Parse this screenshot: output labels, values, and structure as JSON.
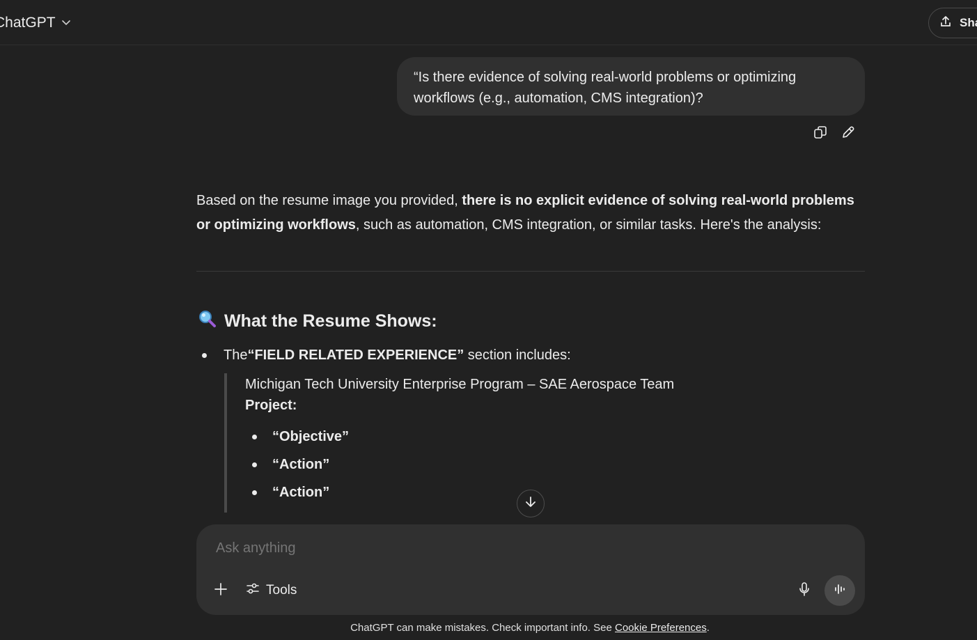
{
  "header": {
    "model_label": "ChatGPT",
    "share_label": "Share"
  },
  "conversation": {
    "user_message": "“Is there evidence of solving real-world problems or optimizing workflows (e.g., automation, CMS integration)?",
    "assistant": {
      "intro_prefix": "Based on the resume image you provided, ",
      "intro_bold": "there is no explicit evidence of solving real-world problems or optimizing workflows",
      "intro_suffix": ", such as automation, CMS integration, or similar tasks. Here's the analysis:",
      "section_title": "What the Resume Shows:",
      "bullet_prefix": "The ",
      "bullet_bold": "“FIELD RELATED EXPERIENCE”",
      "bullet_suffix": " section includes:",
      "quote_line1": "Michigan Tech University Enterprise Program – SAE Aerospace Team",
      "quote_line2": "Project:",
      "quote_items": [
        "“Objective”",
        "“Action”",
        "“Action”"
      ]
    }
  },
  "composer": {
    "placeholder": "Ask anything",
    "tools_label": "Tools"
  },
  "footer": {
    "text": "ChatGPT can make mistakes. Check important info. See ",
    "link": "Cookie Preferences",
    "end": "."
  },
  "icons": {
    "chevron": "chevron-down-icon",
    "share": "share-icon",
    "copy": "copy-icon",
    "edit": "edit-icon",
    "magnifier": "magnifier-emoji-icon",
    "scroll": "arrow-down-icon",
    "plus": "plus-icon",
    "tools": "tools-icon",
    "mic": "microphone-icon",
    "voice": "voice-waveform-icon"
  }
}
